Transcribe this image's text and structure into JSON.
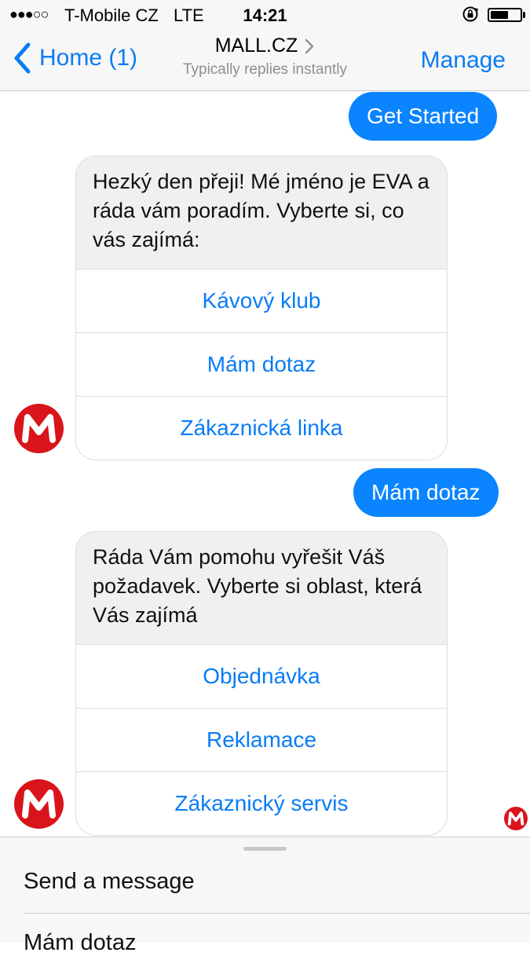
{
  "status_bar": {
    "signal": "●●●○○",
    "carrier": "T-Mobile CZ",
    "network": "LTE",
    "time": "14:21",
    "battery_level": 0.6
  },
  "nav": {
    "back_label": "Home (1)",
    "title": "MALL.CZ",
    "subtitle": "Typically replies instantly",
    "manage_label": "Manage"
  },
  "messages": {
    "get_started": "Get Started",
    "card1": {
      "text": "Hezký den přeji! Mé jméno je EVA a ráda vám poradím. Vyberte si, co vás zajímá:",
      "buttons": [
        "Kávový klub",
        "Mám dotaz",
        "Zákaznická linka"
      ]
    },
    "reply": "Mám dotaz",
    "card2": {
      "text": "Ráda Vám pomohu vyřešit Váš požadavek. Vyberte si oblast, která Vás zajímá",
      "buttons": [
        "Objednávka",
        "Reklamace",
        "Zákaznický servis"
      ]
    }
  },
  "composer": {
    "placeholder": "Send a message",
    "quick_reply": "Mám dotaz"
  },
  "colors": {
    "accent": "#0a7cf5",
    "bubble": "#0a84ff",
    "brand_red": "#d9141c"
  },
  "icons": {
    "back": "chevron-left-icon",
    "title": "chevron-right-icon",
    "avatar": "mall-logo-icon",
    "lock": "rotation-lock-icon",
    "battery": "battery-icon"
  }
}
